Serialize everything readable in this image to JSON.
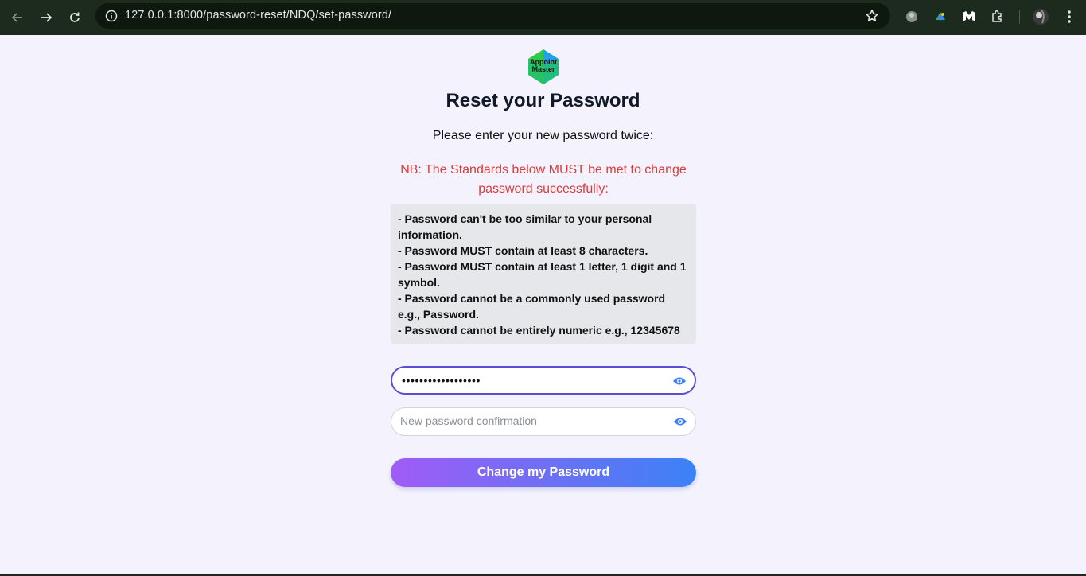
{
  "browser": {
    "url": "127.0.0.1:8000/password-reset/NDQ/set-password/",
    "icons": [
      "back-arrow-icon",
      "forward-arrow-icon",
      "reload-icon",
      "site-info-icon",
      "bookmark-star-icon",
      "extensions-icon",
      "profile-avatar",
      "more-menu-icon"
    ]
  },
  "page": {
    "logo_text_line1": "Appoint",
    "logo_text_line2": "Master",
    "title": "Reset your Password",
    "subtitle": "Please enter your new password twice:",
    "warning": "NB: The Standards below MUST be met to change password successfully:",
    "rules": [
      "- Password can't be too similar to your personal information.",
      "- Password MUST contain at least 8 characters.",
      "- Password MUST contain at least 1 letter, 1 digit and 1 symbol.",
      "- Password cannot be a commonly used password e.g., Password.",
      "- Password cannot be entirely numeric e.g., 12345678"
    ],
    "password_value": "••••••••••••••••••",
    "confirm_placeholder": "New password confirmation",
    "submit_label": "Change my Password"
  },
  "colors": {
    "warning": "#dc3b3b",
    "focus_border": "#5b4fd1",
    "button_gradient_start": "#a05cf6",
    "button_gradient_end": "#3b82f6",
    "eye_icon": "#3b82f6"
  }
}
